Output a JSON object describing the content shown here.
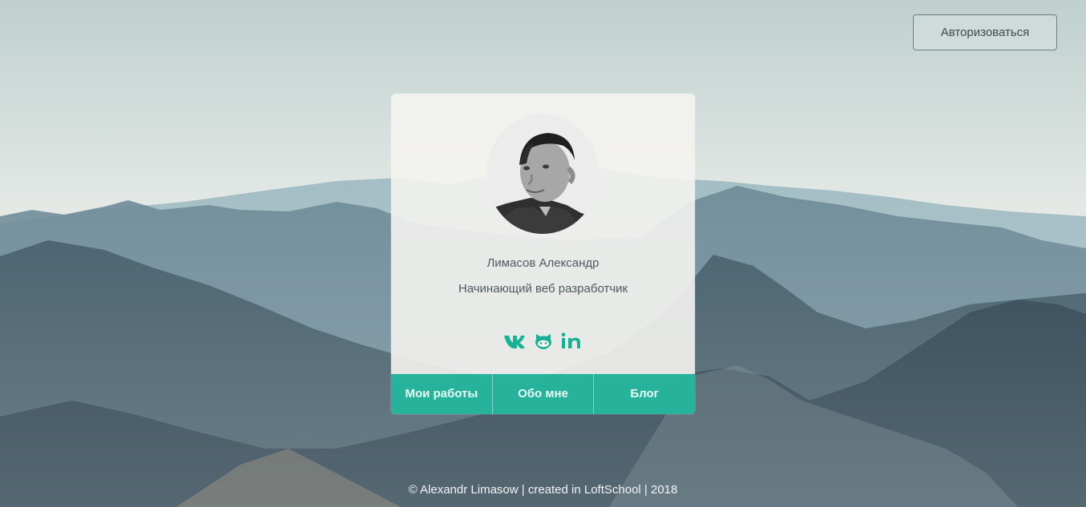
{
  "header": {
    "login_label": "Авторизоваться"
  },
  "profile": {
    "name": "Лимасов Александр",
    "role": "Начинающий веб разработчик",
    "social_icons": [
      "vk-icon",
      "github-icon",
      "linkedin-icon"
    ]
  },
  "nav": {
    "items": [
      "Мои работы",
      "Обо мне",
      "Блог"
    ]
  },
  "footer": {
    "text": "© Alexandr Limasow | created in LoftSchool | 2018"
  },
  "colors": {
    "accent": "#16ae95",
    "card": "#f4f3ef",
    "text": "#4f5a60"
  }
}
